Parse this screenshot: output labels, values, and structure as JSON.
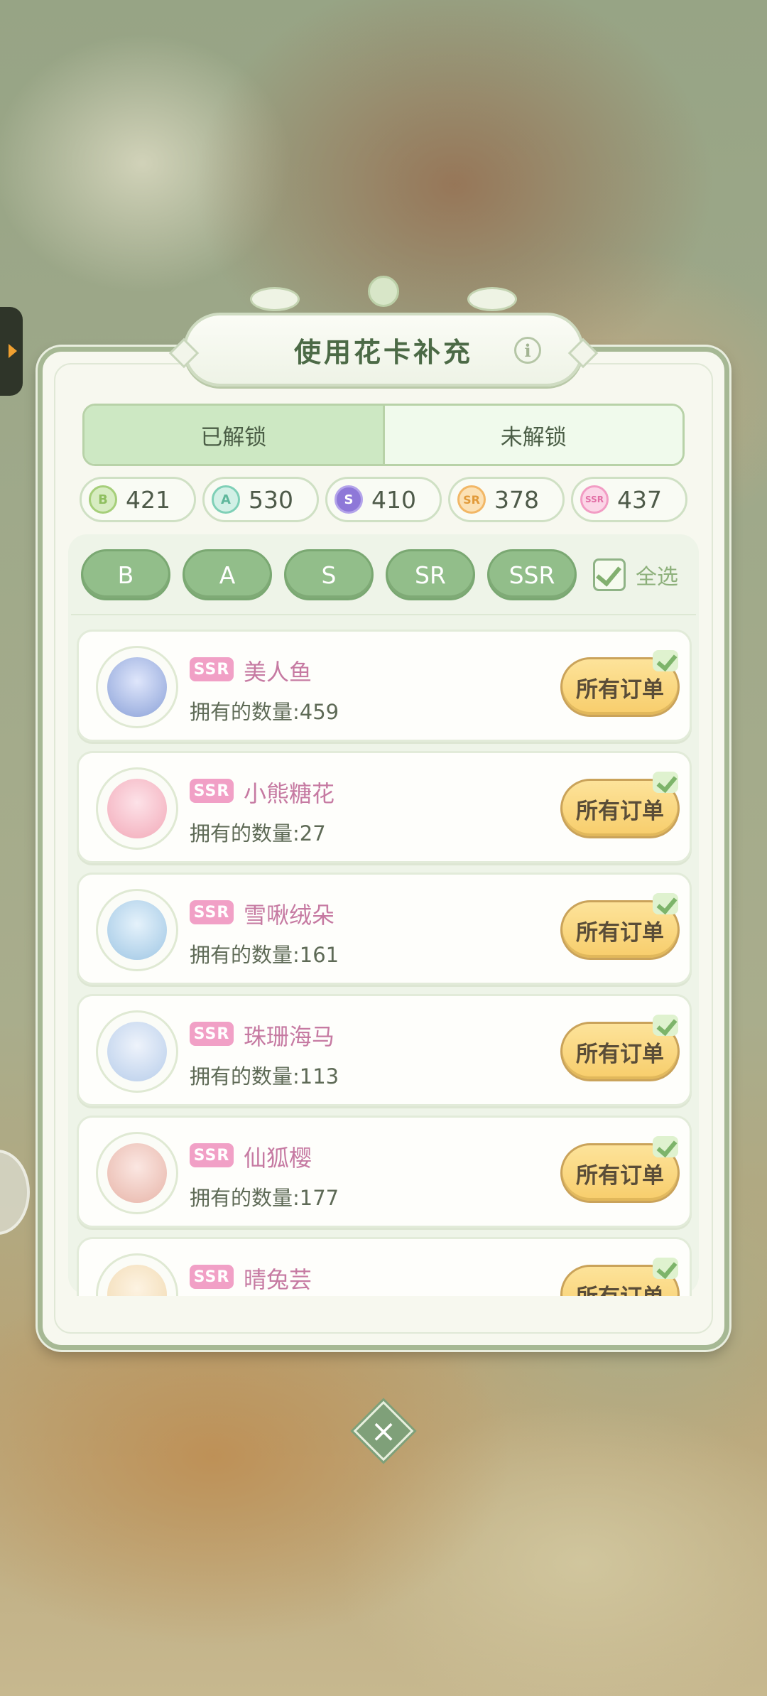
{
  "title": "使用花卡补充",
  "info_icon": "info-icon",
  "tabs": [
    {
      "label": "已解锁",
      "active": true
    },
    {
      "label": "未解锁",
      "active": false
    }
  ],
  "counts": [
    {
      "grade": "B",
      "value": "421",
      "color": "#a6cf7a"
    },
    {
      "grade": "A",
      "value": "530",
      "color": "#7fd0b7"
    },
    {
      "grade": "S",
      "value": "410",
      "color": "#9b86e0"
    },
    {
      "grade": "SR",
      "value": "378",
      "color": "#f2b766"
    },
    {
      "grade": "SSR",
      "value": "437",
      "color": "#f29cc4"
    }
  ],
  "filters": [
    "B",
    "A",
    "S",
    "SR",
    "SSR"
  ],
  "select_all": {
    "label": "全选",
    "checked": true
  },
  "items": [
    {
      "tag": "SSR",
      "name": "美人鱼",
      "count": "拥有的数量:459",
      "button": "所有订单",
      "art": "#8aa1d8"
    },
    {
      "tag": "SSR",
      "name": "小熊糖花",
      "count": "拥有的数量:27",
      "button": "所有订单",
      "art": "#f2a9b8"
    },
    {
      "tag": "SSR",
      "name": "雪啾绒朵",
      "count": "拥有的数量:161",
      "button": "所有订单",
      "art": "#9ec6e4"
    },
    {
      "tag": "SSR",
      "name": "珠珊海马",
      "count": "拥有的数量:113",
      "button": "所有订单",
      "art": "#b7cdea"
    },
    {
      "tag": "SSR",
      "name": "仙狐樱",
      "count": "拥有的数量:177",
      "button": "所有订单",
      "art": "#e7b4a8"
    },
    {
      "tag": "SSR",
      "name": "晴兔芸",
      "count": "",
      "button": "所有订单",
      "art": "#f1d9b0"
    }
  ],
  "close_icon": "close-icon"
}
